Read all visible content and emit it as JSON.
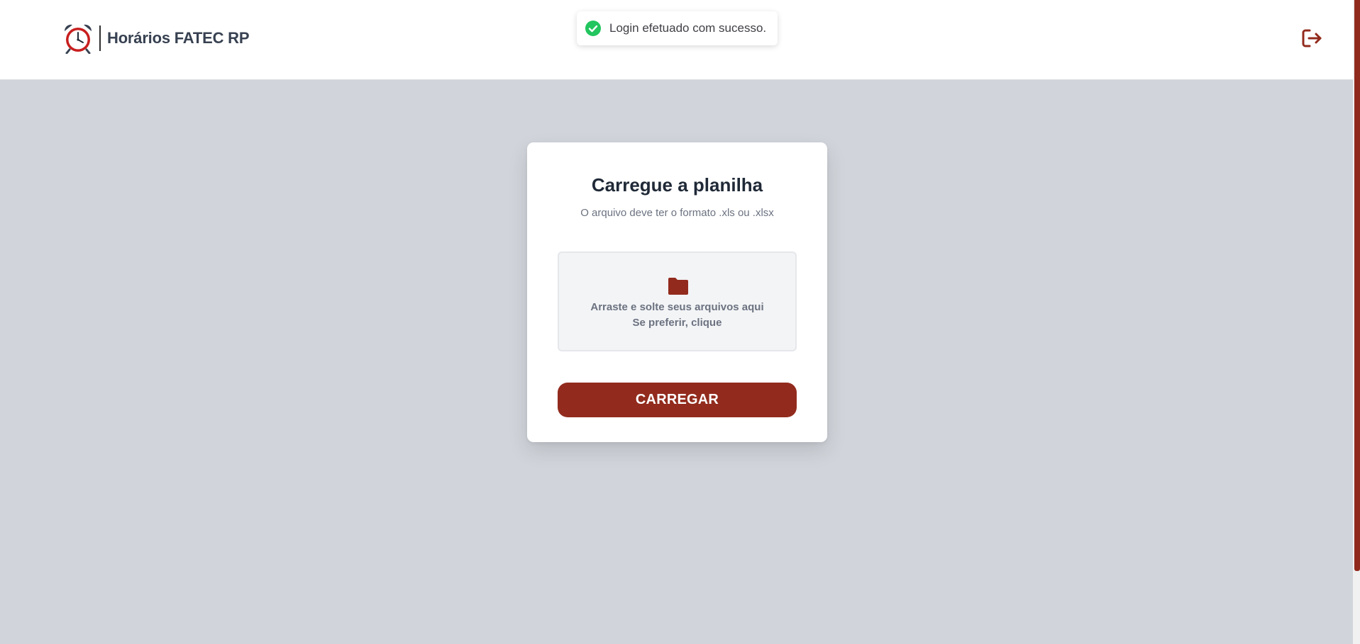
{
  "header": {
    "logo_icon": "alarm-clock-icon",
    "title": "Horários FATEC RP",
    "logout_icon": "logout-icon"
  },
  "toast": {
    "icon": "check-circle-icon",
    "message": "Login efetuado com sucesso."
  },
  "upload_card": {
    "title": "Carregue a planilha",
    "subtitle": "O arquivo deve ter o formato .xls ou .xlsx",
    "dropzone": {
      "icon": "folder-icon",
      "line1": "Arraste e solte seus arquivos aqui",
      "line2": "Se preferir, clique"
    },
    "submit_label": "CARREGAR"
  },
  "colors": {
    "brand": "#922b1d",
    "background": "#d1d5db",
    "success": "#22c55e"
  }
}
